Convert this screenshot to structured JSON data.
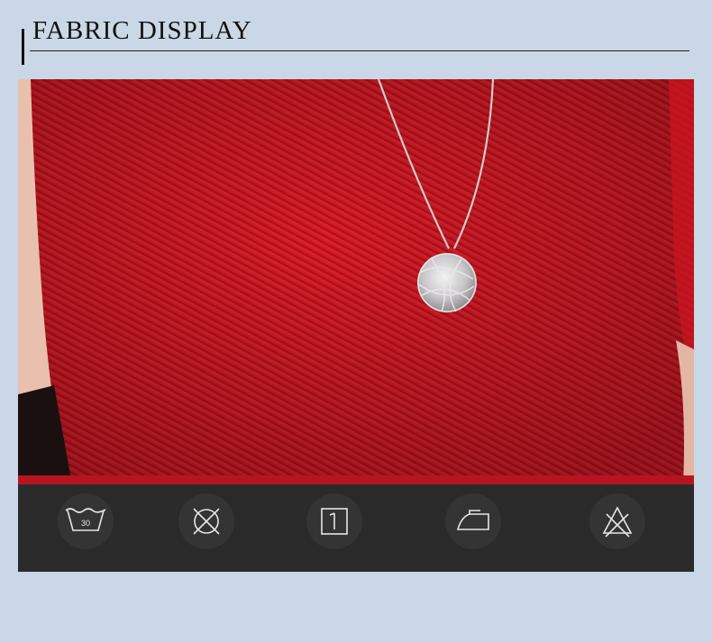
{
  "header": {
    "title": "FABRIC DISPLAY"
  },
  "photo": {
    "subject": "red-pleated-fabric-with-pendant-necklace"
  },
  "care_icons": [
    {
      "name": "wash-30-icon",
      "label": "30"
    },
    {
      "name": "do-not-tumble-dry-icon"
    },
    {
      "name": "drip-dry-icon"
    },
    {
      "name": "iron-icon"
    },
    {
      "name": "do-not-bleach-icon"
    }
  ],
  "colors": {
    "background": "#c9d7e6",
    "fabric": "#d41a25",
    "care_bar": "#2b2a2b",
    "icon_stroke": "#e6e6e6"
  }
}
